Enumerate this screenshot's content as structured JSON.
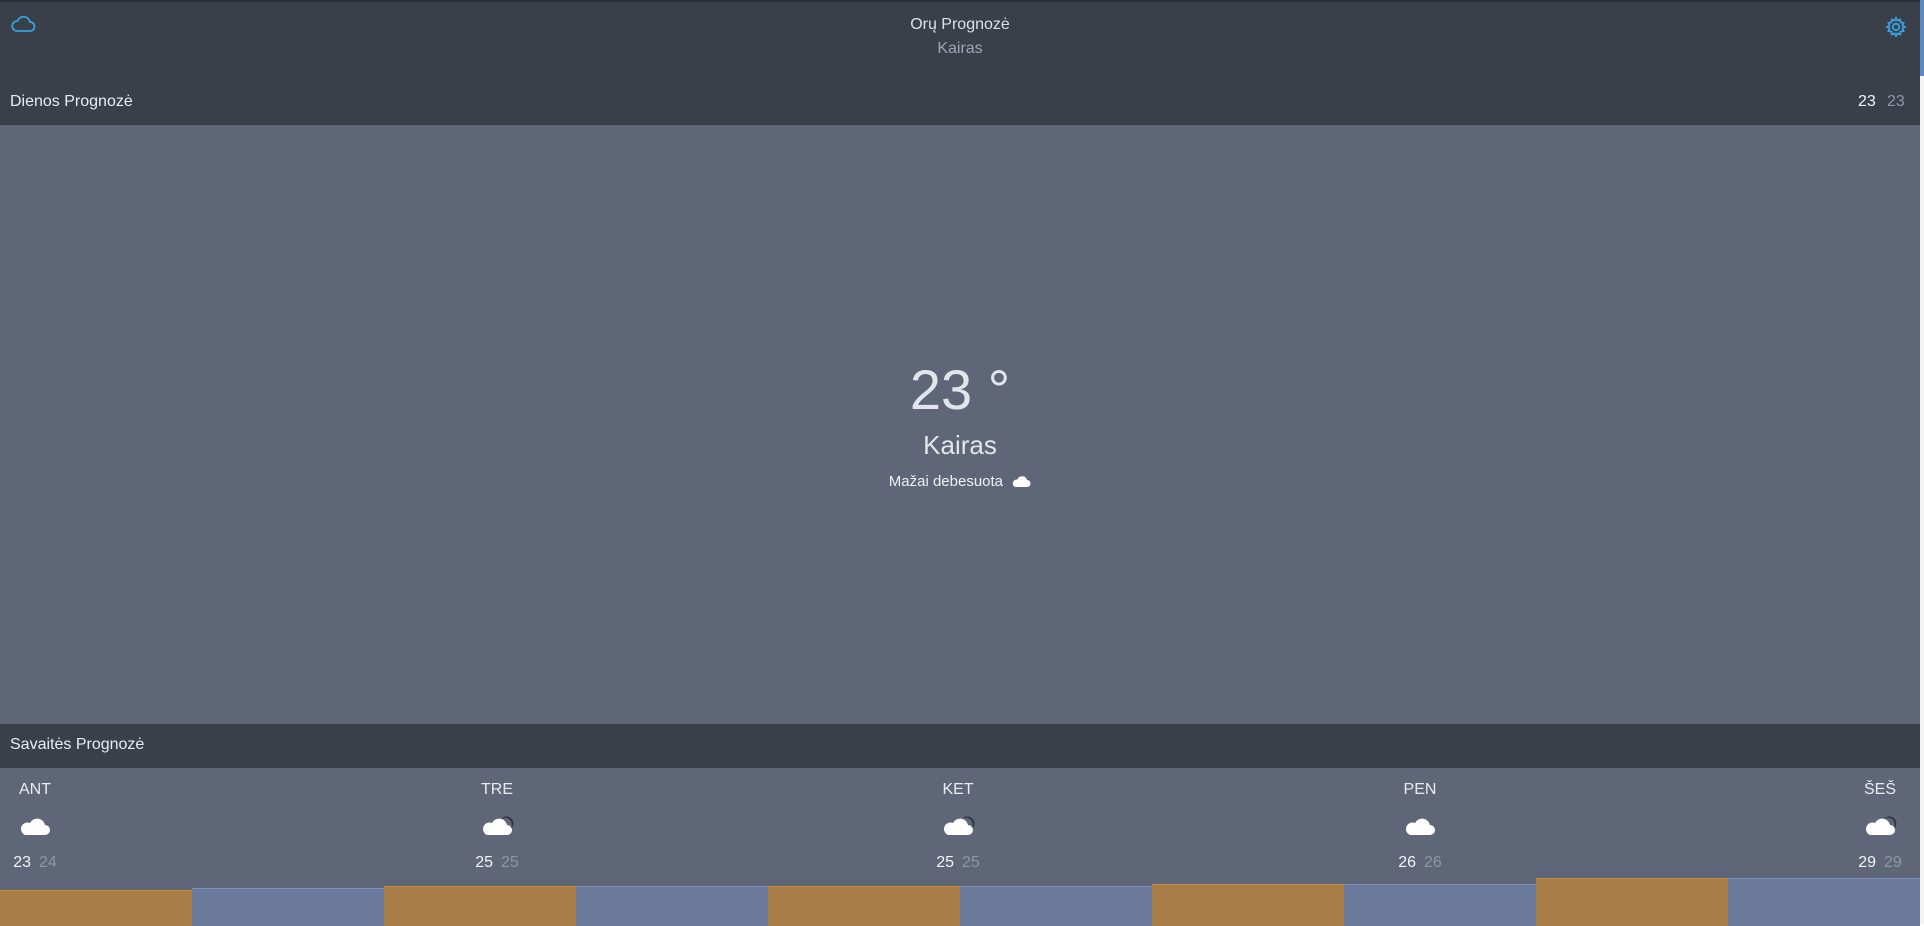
{
  "header": {
    "title": "Orų Prognozė",
    "subtitle": "Kairas",
    "left_icon": "cloud-icon",
    "right_icon": "gear-icon",
    "accent": "#3aa0e0"
  },
  "day_forecast": {
    "label": "Dienos Prognozė",
    "high": "23",
    "low": "23"
  },
  "current": {
    "temperature": "23 °",
    "city": "Kairas",
    "description": "Mažai debesuota",
    "icon": "cloud-icon"
  },
  "week_forecast": {
    "label": "Savaitės Prognozė",
    "days": [
      {
        "name": "ANT",
        "icon": "cloud-icon",
        "high": "23",
        "low": "24"
      },
      {
        "name": "TRE",
        "icon": "cloud-night-icon",
        "high": "25",
        "low": "25"
      },
      {
        "name": "KET",
        "icon": "cloud-night-icon",
        "high": "25",
        "low": "25"
      },
      {
        "name": "PEN",
        "icon": "cloud-icon",
        "high": "26",
        "low": "26"
      },
      {
        "name": "ŠEŠ",
        "icon": "cloud-night-icon",
        "high": "29",
        "low": "29"
      }
    ],
    "bar_colors": {
      "high": "#a87d48",
      "low": "#6b7a9a"
    }
  }
}
